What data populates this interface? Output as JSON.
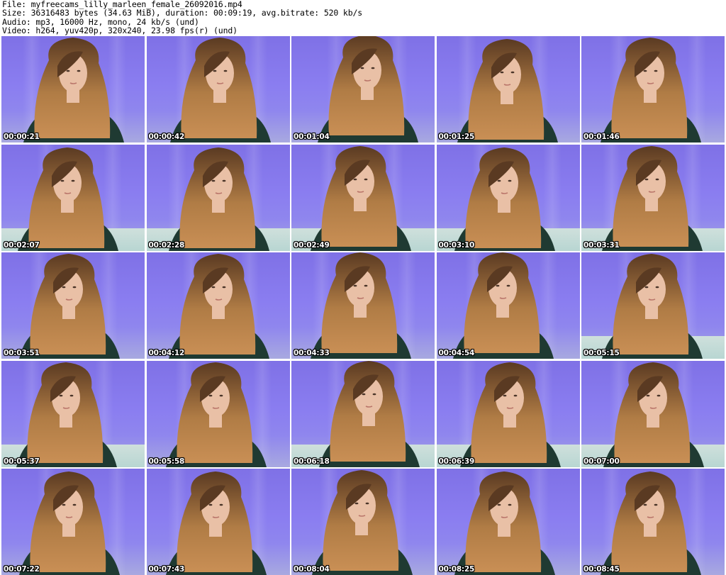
{
  "header": {
    "file_line": "File: myfreecams_lilly_marleen_female_26092016.mp4",
    "size_line": "Size: 36316483 bytes (34.63 MiB), duration: 00:09:19, avg.bitrate: 520 kb/s",
    "audio_line": "Audio: mp3, 16000 Hz, mono, 24 kb/s (und)",
    "video_line": "Video: h264, yuv420p, 320x240, 23.98 fps(r) (und)"
  },
  "colors": {
    "wall": "#8a7df0",
    "hair_dark": "#5a3a22",
    "hair_light": "#b07c45",
    "skin": "#e9c0a6",
    "top": "#1f3a32"
  },
  "thumbnails": [
    {
      "timestamp": "00:00:21"
    },
    {
      "timestamp": "00:00:42"
    },
    {
      "timestamp": "00:01:04"
    },
    {
      "timestamp": "00:01:25"
    },
    {
      "timestamp": "00:01:46"
    },
    {
      "timestamp": "00:02:07"
    },
    {
      "timestamp": "00:02:28"
    },
    {
      "timestamp": "00:02:49"
    },
    {
      "timestamp": "00:03:10"
    },
    {
      "timestamp": "00:03:31"
    },
    {
      "timestamp": "00:03:51"
    },
    {
      "timestamp": "00:04:12"
    },
    {
      "timestamp": "00:04:33"
    },
    {
      "timestamp": "00:04:54"
    },
    {
      "timestamp": "00:05:15"
    },
    {
      "timestamp": "00:05:37"
    },
    {
      "timestamp": "00:05:58"
    },
    {
      "timestamp": "00:06:18"
    },
    {
      "timestamp": "00:06:39"
    },
    {
      "timestamp": "00:07:00"
    },
    {
      "timestamp": "00:07:22"
    },
    {
      "timestamp": "00:07:43"
    },
    {
      "timestamp": "00:08:04"
    },
    {
      "timestamp": "00:08:25"
    },
    {
      "timestamp": "00:08:45"
    }
  ]
}
